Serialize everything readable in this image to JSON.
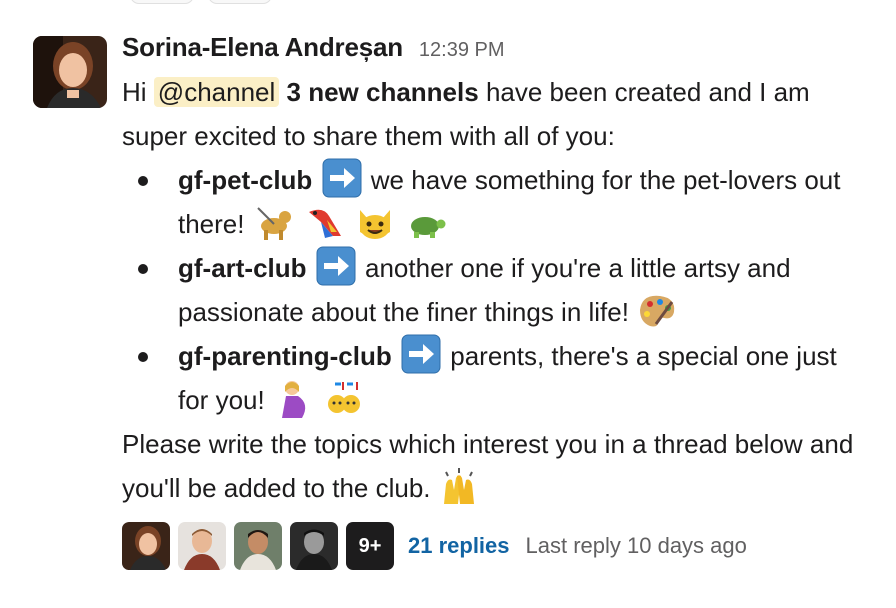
{
  "message": {
    "author": "Sorina-Elena Andreșan",
    "timestamp": "12:39 PM",
    "intro": {
      "hi": "Hi",
      "mention": "@channel",
      "bold": "3 new channels",
      "rest": "have been created and I am super excited to share them with all of you:"
    },
    "items": [
      {
        "channel": "gf-pet-club",
        "text": "we have something for the pet-lovers out there!",
        "emojis": [
          "guide-dog",
          "parrot",
          "smiley-cat",
          "turtle"
        ]
      },
      {
        "channel": "gf-art-club",
        "text": "another one if you're a little artsy and passionate about the finer things in life!",
        "emojis": [
          "artist-palette"
        ]
      },
      {
        "channel": "gf-parenting-club",
        "text": "parents, there's a special one just for you!",
        "emojis": [
          "pregnant-woman",
          "confused-babies"
        ]
      }
    ],
    "closing": "Please write the topics which interest you in a thread below and you'll be added to the club.",
    "closing_emoji": "raising-hands"
  },
  "thread": {
    "more_count": "9+",
    "replies": "21 replies",
    "last_reply": "Last reply 10 days ago"
  },
  "colors": {
    "mention_bg": "#fbefc6",
    "link": "#1264a3",
    "muted": "#616061",
    "arrow_emoji_bg": "#4a8fcf"
  }
}
